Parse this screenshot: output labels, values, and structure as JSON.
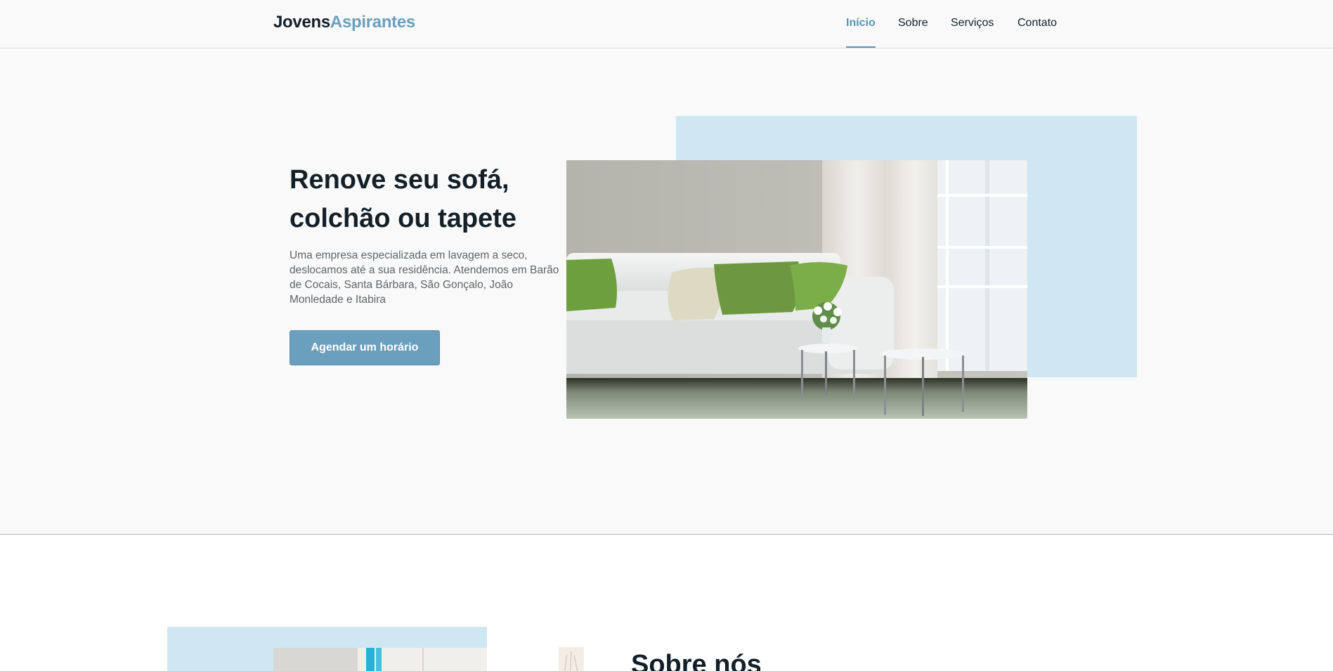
{
  "brand": {
    "part1": "Jovens",
    "part2": "Aspirantes"
  },
  "nav": {
    "items": [
      {
        "label": "Início",
        "active": true
      },
      {
        "label": "Sobre",
        "active": false
      },
      {
        "label": "Serviços",
        "active": false
      },
      {
        "label": "Contato",
        "active": false
      }
    ]
  },
  "hero": {
    "title_line1": "Renove seu sofá,",
    "title_line2": "colchão ou tapete",
    "description": "Uma empresa especializada em lavagem a seco, deslocamos até a sua residência. Atendemos em Barão de Cocais, Santa Bárbara, São Gonçalo, João Monledade e Itabira",
    "cta_label": "Agendar um horário"
  },
  "about": {
    "title": "Sobre nós"
  },
  "colors": {
    "accent": "#6a9fbd",
    "accent_light_block": "#cfe6f3",
    "text_dark": "#132029",
    "text_muted": "#5f6468"
  }
}
